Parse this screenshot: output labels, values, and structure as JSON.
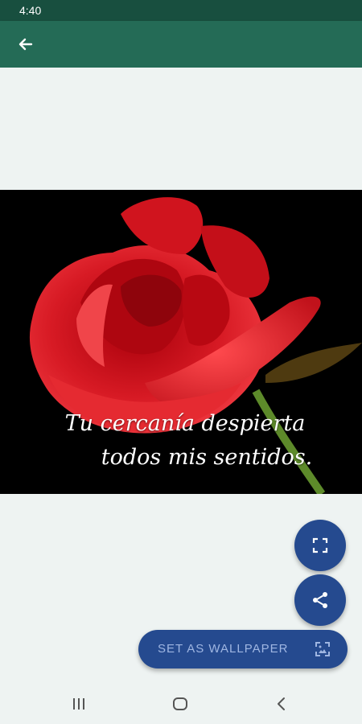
{
  "status_bar": {
    "time": "4:40"
  },
  "app_bar": {
    "back_icon": "arrow-left-icon"
  },
  "wallpaper": {
    "quote_line_1": "Tu cercanía despierta",
    "quote_line_2": "todos mis sentidos."
  },
  "actions": {
    "fullscreen_icon": "fullscreen-icon",
    "share_icon": "share-icon",
    "set_wallpaper_label": "SET AS WALLPAPER",
    "wallpaper_icon": "wallpaper-icon"
  },
  "nav_bar": {
    "recents_icon": "recents-icon",
    "home_icon": "home-icon",
    "back_icon": "chevron-left-icon"
  },
  "colors": {
    "status_bar": "#184f3f",
    "app_bar": "#246b56",
    "background": "#eef3f2",
    "fab": "#254a8f",
    "fab_label": "#9fb6e2"
  }
}
